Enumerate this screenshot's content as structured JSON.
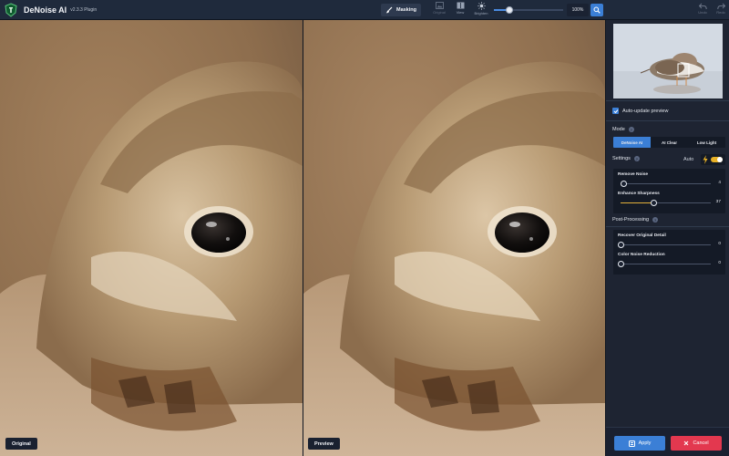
{
  "app": {
    "title": "DeNoise AI",
    "version": "v2.3.3 Plugin"
  },
  "toolbar": {
    "masking_label": "Masking",
    "original_label": "Original",
    "view_label": "View",
    "brighten_label": "Brighten",
    "brighten_level": 0.22,
    "zoom": "100%",
    "undo_label": "Undo",
    "redo_label": "Redo"
  },
  "panes": {
    "left_label": "Original",
    "right_label": "Preview"
  },
  "sidebar": {
    "auto_update_label": "Auto-update preview",
    "auto_update_checked": true,
    "mode_title": "Mode",
    "modes": [
      "DeNoise AI",
      "AI Clear",
      "Low Light"
    ],
    "active_mode": 0,
    "settings_title": "Settings",
    "auto_label": "Auto",
    "auto_enabled": true,
    "settings": [
      {
        "name": "Remove Noise",
        "value": "4",
        "level": 0.04
      },
      {
        "name": "Enhance Sharpness",
        "value": "37",
        "level": 0.37
      }
    ],
    "post_title": "Post-Processing",
    "post": [
      {
        "name": "Recover Original Detail",
        "value": "0",
        "level": 0
      },
      {
        "name": "Color Noise Reduction",
        "value": "0",
        "level": 0
      }
    ],
    "apply_label": "Apply",
    "cancel_label": "Cancel"
  },
  "colors": {
    "accent": "#3b7fd6",
    "cancel": "#e3384f",
    "toggle": "#e8b126"
  }
}
